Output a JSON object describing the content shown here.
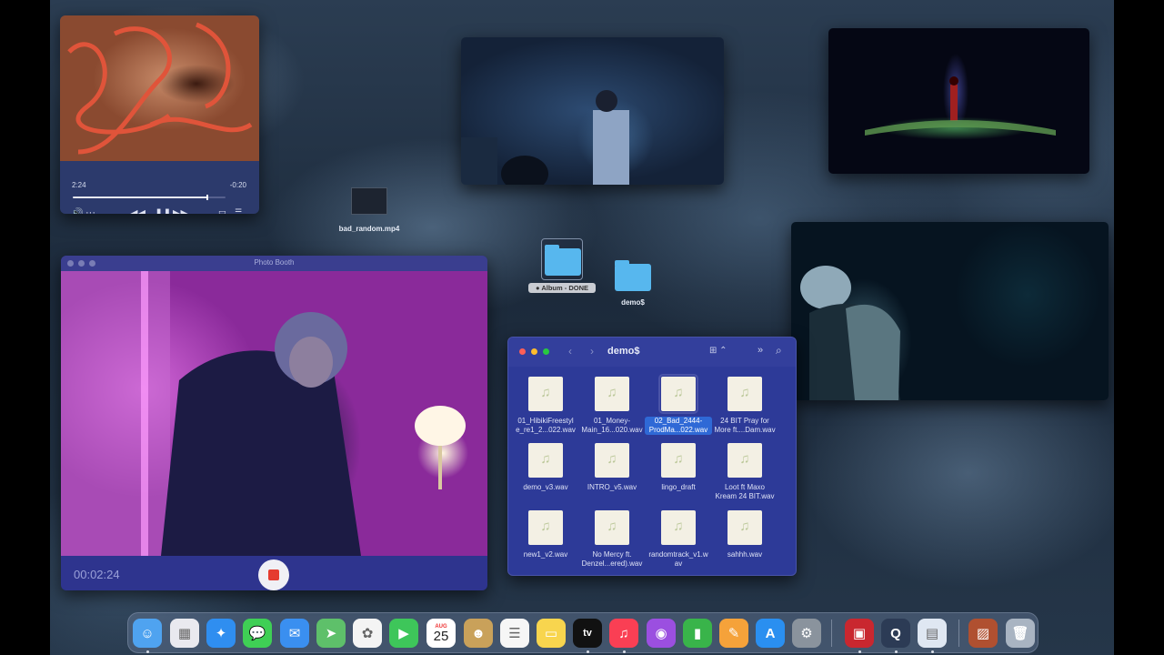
{
  "player": {
    "elapsed": "2:24",
    "remaining": "-0:20",
    "progress": 0.88,
    "volume_icon": "speaker-icon",
    "more_icon": "ellipsis-icon",
    "rewind_icon": "rewind-icon",
    "pause_icon": "pause-icon",
    "forward_icon": "fast-forward-icon"
  },
  "photo_booth": {
    "title": "Photo Booth",
    "elapsed": "00:02:24"
  },
  "desktop": {
    "video_file": "bad_random.mp4",
    "folder_album": "Album - DONE",
    "folder_demo": "demo$"
  },
  "finder": {
    "title": "demo$",
    "files": [
      "01_HibikiFreestyl\ne_re1_2...022.wav",
      "01_Money-\nMain_16...020.wav",
      "02_Bad_2444-\nProdMa...022.wav",
      "24 BIT Pray for\nMore ft....Dam.wav",
      "demo_v3.wav",
      "INTRO_v5.wav",
      "lingo_draft",
      "Loot ft Maxo\nKream 24 BIT.wav",
      "new1_v2.wav",
      "No Mercy ft.\nDenzel...ered).wav",
      "randomtrack_v1.w\nav",
      "sahhh.wav"
    ],
    "selected_index": 2
  },
  "dock": {
    "calendar_month": "AUG",
    "calendar_day": "25",
    "tv_label": "tv",
    "apps": [
      "finder",
      "launchpad",
      "safari",
      "messages",
      "mail",
      "maps",
      "photos",
      "facetime",
      "calendar",
      "contacts",
      "reminders",
      "notes",
      "tv",
      "music",
      "podcasts",
      "numbers",
      "pages",
      "app-store",
      "system-preferences",
      "photo-booth",
      "quicktime",
      "preview",
      "album-art",
      "trash"
    ]
  },
  "colors": {
    "finder_bg": "#2d3a98",
    "booth_bg": "#2e348e",
    "folder": "#57b7ee",
    "selection": "#2f69d6",
    "record": "#e53b2f"
  }
}
